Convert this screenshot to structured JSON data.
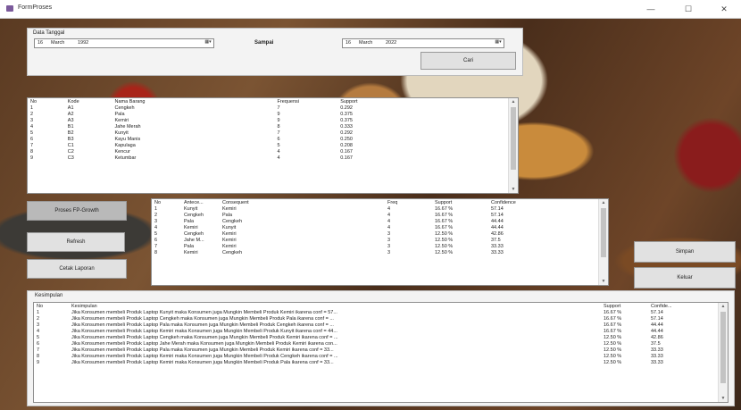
{
  "window": {
    "title": "FormProses",
    "minimize": "—",
    "maximize": "☐",
    "close": "✕"
  },
  "date_group": {
    "label": "Data Tanggal",
    "from": {
      "day": "16",
      "month": "March",
      "year": "1992"
    },
    "to": {
      "day": "16",
      "month": "March",
      "year": "2022"
    },
    "separator": "Sampai",
    "dropdown_glyph": "▦▾"
  },
  "buttons": {
    "cari": "Cari",
    "proses": "Proses FP-Growth",
    "refresh": "Refresh",
    "cetak": "Cetak Laporan",
    "simpan": "Simpan",
    "keluar": "Keluar"
  },
  "barang_table": {
    "headers": [
      "No",
      "Kode",
      "Nama Barang",
      "Frequensi",
      "Support"
    ],
    "rows": [
      [
        "1",
        "A1",
        "Cengkeh",
        "7",
        "0.292"
      ],
      [
        "2",
        "A2",
        "Pala",
        "9",
        "0.375"
      ],
      [
        "3",
        "A3",
        "Kemiri",
        "9",
        "0.375"
      ],
      [
        "4",
        "B1",
        "Jahe Merah",
        "8",
        "0.333"
      ],
      [
        "5",
        "B2",
        "Kunyit",
        "7",
        "0.292"
      ],
      [
        "6",
        "B3",
        "Kayu Manis",
        "6",
        "0.250"
      ],
      [
        "7",
        "C1",
        "Kapulaga",
        "5",
        "0.208"
      ],
      [
        "8",
        "C2",
        "Kencur",
        "4",
        "0.167"
      ],
      [
        "9",
        "C3",
        "Ketumbar",
        "4",
        "0.167"
      ]
    ]
  },
  "rules_table": {
    "headers": [
      "No",
      "Antece...",
      "Consequent",
      "Freq",
      "Support",
      "Confidence"
    ],
    "rows": [
      [
        "1",
        "Kunyit",
        "Kemiri",
        "4",
        "16.67 %",
        "57.14"
      ],
      [
        "2",
        "Cengkeh",
        "Pala",
        "4",
        "16.67 %",
        "57.14"
      ],
      [
        "3",
        "Pala",
        "Cengkeh",
        "4",
        "16.67 %",
        "44.44"
      ],
      [
        "4",
        "Kemiri",
        "Kunyit",
        "4",
        "16.67 %",
        "44.44"
      ],
      [
        "5",
        "Cengkeh",
        "Kemiri",
        "3",
        "12.50 %",
        "42.86"
      ],
      [
        "6",
        "Jahe M...",
        "Kemiri",
        "3",
        "12.50 %",
        "37.5"
      ],
      [
        "7",
        "Pala",
        "Kemiri",
        "3",
        "12.50 %",
        "33.33"
      ],
      [
        "8",
        "Kemiri",
        "Cengkeh",
        "3",
        "12.50 %",
        "33.33"
      ]
    ]
  },
  "kesimpulan": {
    "label": "Kesimpulan",
    "headers": [
      "No",
      "Kesimpulan",
      "Support",
      "Confide..."
    ],
    "rows": [
      [
        "1",
        "Jika Konsumen membeli Produk Laptop Kunyit maka Konsumen juga Mungkin Membeli Produk  Kemiri ikarena conf = 57...",
        "16.67 %",
        "57.14"
      ],
      [
        "2",
        "Jika Konsumen membeli Produk Laptop Cengkeh maka Konsumen juga Mungkin Membeli Produk  Pala ikarena conf = ...",
        "16.67 %",
        "57.14"
      ],
      [
        "3",
        "Jika Konsumen membeli Produk Laptop Pala maka Konsumen juga Mungkin Membeli Produk  Cengkeh ikarena conf = ...",
        "16.67 %",
        "44.44"
      ],
      [
        "4",
        "Jika Konsumen membeli Produk Laptop Kemiri maka Konsumen juga Mungkin Membeli Produk  Kunyit ikarena conf = 44...",
        "16.67 %",
        "44.44"
      ],
      [
        "5",
        "Jika Konsumen membeli Produk Laptop Cengkeh maka Konsumen juga Mungkin Membeli Produk  Kemiri ikarena conf = ...",
        "12.50 %",
        "42.86"
      ],
      [
        "6",
        "Jika Konsumen membeli Produk Laptop Jahe Merah maka Konsumen juga Mungkin Membeli Produk  Kemiri ikarena con...",
        "12.50 %",
        "37.5"
      ],
      [
        "7",
        "Jika Konsumen membeli Produk Laptop Pala maka Konsumen juga Mungkin Membeli Produk  Kemiri ikarena conf = 33...",
        "12.50 %",
        "33.33"
      ],
      [
        "8",
        "Jika Konsumen membeli Produk Laptop Kemiri maka Konsumen juga Mungkin Membeli Produk  Cengkeh ikarena conf = ...",
        "12.50 %",
        "33.33"
      ],
      [
        "9",
        "Jika Konsumen membeli Produk Laptop Kemiri maka Konsumen juga Mungkin Membeli Produk  Pala ikarena conf = 33...",
        "12.50 %",
        "33.33"
      ]
    ]
  }
}
